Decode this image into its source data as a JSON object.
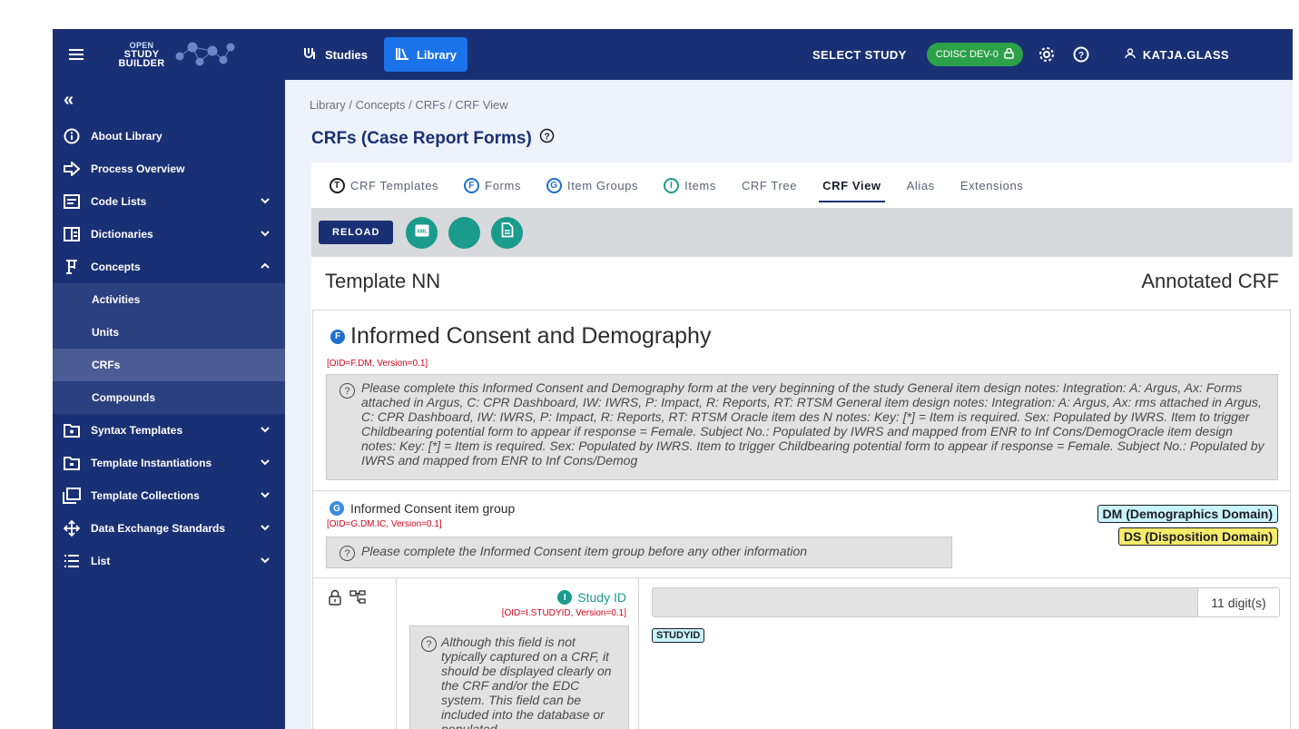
{
  "topbar": {
    "logo_line1": "OPEN",
    "logo_line2": "STUDY",
    "logo_line3": "BUILDER",
    "studies_label": "Studies",
    "library_label": "Library",
    "select_study_label": "SELECT STUDY",
    "study_pill": "CDISC DEV-0",
    "user_label": "KATJA.GLASS"
  },
  "sidebar": {
    "collapse_glyph": "«",
    "items": [
      {
        "label": "About Library"
      },
      {
        "label": "Process Overview"
      },
      {
        "label": "Code Lists"
      },
      {
        "label": "Dictionaries"
      },
      {
        "label": "Concepts"
      },
      {
        "label": "Syntax Templates"
      },
      {
        "label": "Template Instantiations"
      },
      {
        "label": "Template Collections"
      },
      {
        "label": "Data Exchange Standards"
      },
      {
        "label": "List"
      }
    ],
    "concepts_sub": [
      {
        "label": "Activities"
      },
      {
        "label": "Units"
      },
      {
        "label": "CRFs"
      },
      {
        "label": "Compounds"
      }
    ]
  },
  "main": {
    "breadcrumb": "Library / Concepts / CRFs / CRF View",
    "title": "CRFs (Case Report Forms)",
    "tabs": [
      {
        "label": "CRF Templates",
        "badge": "T"
      },
      {
        "label": "Forms",
        "badge": "F"
      },
      {
        "label": "Item Groups",
        "badge": "G"
      },
      {
        "label": "Items",
        "badge": "I"
      },
      {
        "label": "CRF Tree"
      },
      {
        "label": "CRF View"
      },
      {
        "label": "Alias"
      },
      {
        "label": "Extensions"
      }
    ],
    "reload_label": "RELOAD",
    "xml_icon_text": "XML"
  },
  "crf": {
    "template_name": "Template NN",
    "annotated_label": "Annotated CRF",
    "form": {
      "badge": "F",
      "title": "Informed Consent and Demography",
      "oid": "[OID=F.DM, Version=0.1]",
      "notes": "Please complete this Informed Consent and Demography form at the very beginning of the study General item design notes: Integration: A: Argus, Ax: Forms attached in Argus, C: CPR Dashboard, IW: IWRS, P: Impact, R: Reports, RT: RTSM General item design notes: Integration: A: Argus, Ax: rms attached in Argus, C: CPR Dashboard, IW: IWRS, P: Impact, R: Reports, RT: RTSM Oracle item des N notes: Key: [*] = Item is required. Sex: Populated by IWRS. Item to trigger Childbearing potential form to appear if response = Female. Subject No.: Populated by IWRS and mapped from ENR to Inf Cons/DemogOracle item design notes: Key: [*] = Item is required. Sex: Populated by IWRS. Item to trigger Childbearing potential form to appear if response = Female. Subject No.: Populated by IWRS and mapped from ENR to Inf Cons/Demog"
    },
    "group": {
      "badge": "G",
      "title": "Informed Consent item group",
      "oid": "[OID=G.DM.IC, Version=0.1]",
      "notes": "Please complete the Informed Consent item group before any other information",
      "domains": [
        "DM (Demographics Domain)",
        "DS (Disposition Domain)"
      ]
    },
    "item": {
      "badge": "I",
      "title": "Study ID",
      "oid": "[OID=I.STUDYID, Version=0.1]",
      "notes": "Although this field is not typically captured on a CRF, it should be displayed clearly on the CRF and/or the EDC system. This field can be included into the database or populated",
      "unit": "11 digit(s)",
      "variable": "STUDYID"
    }
  },
  "colors": {
    "nav_bg": "#193074",
    "active_tab": "#1a73e8",
    "study_pill": "#2da04a",
    "teal": "#1b9b8c",
    "dm_domain": "#c9f4fb",
    "ds_domain": "#f7ec6a",
    "oid_red": "#d0021b"
  }
}
